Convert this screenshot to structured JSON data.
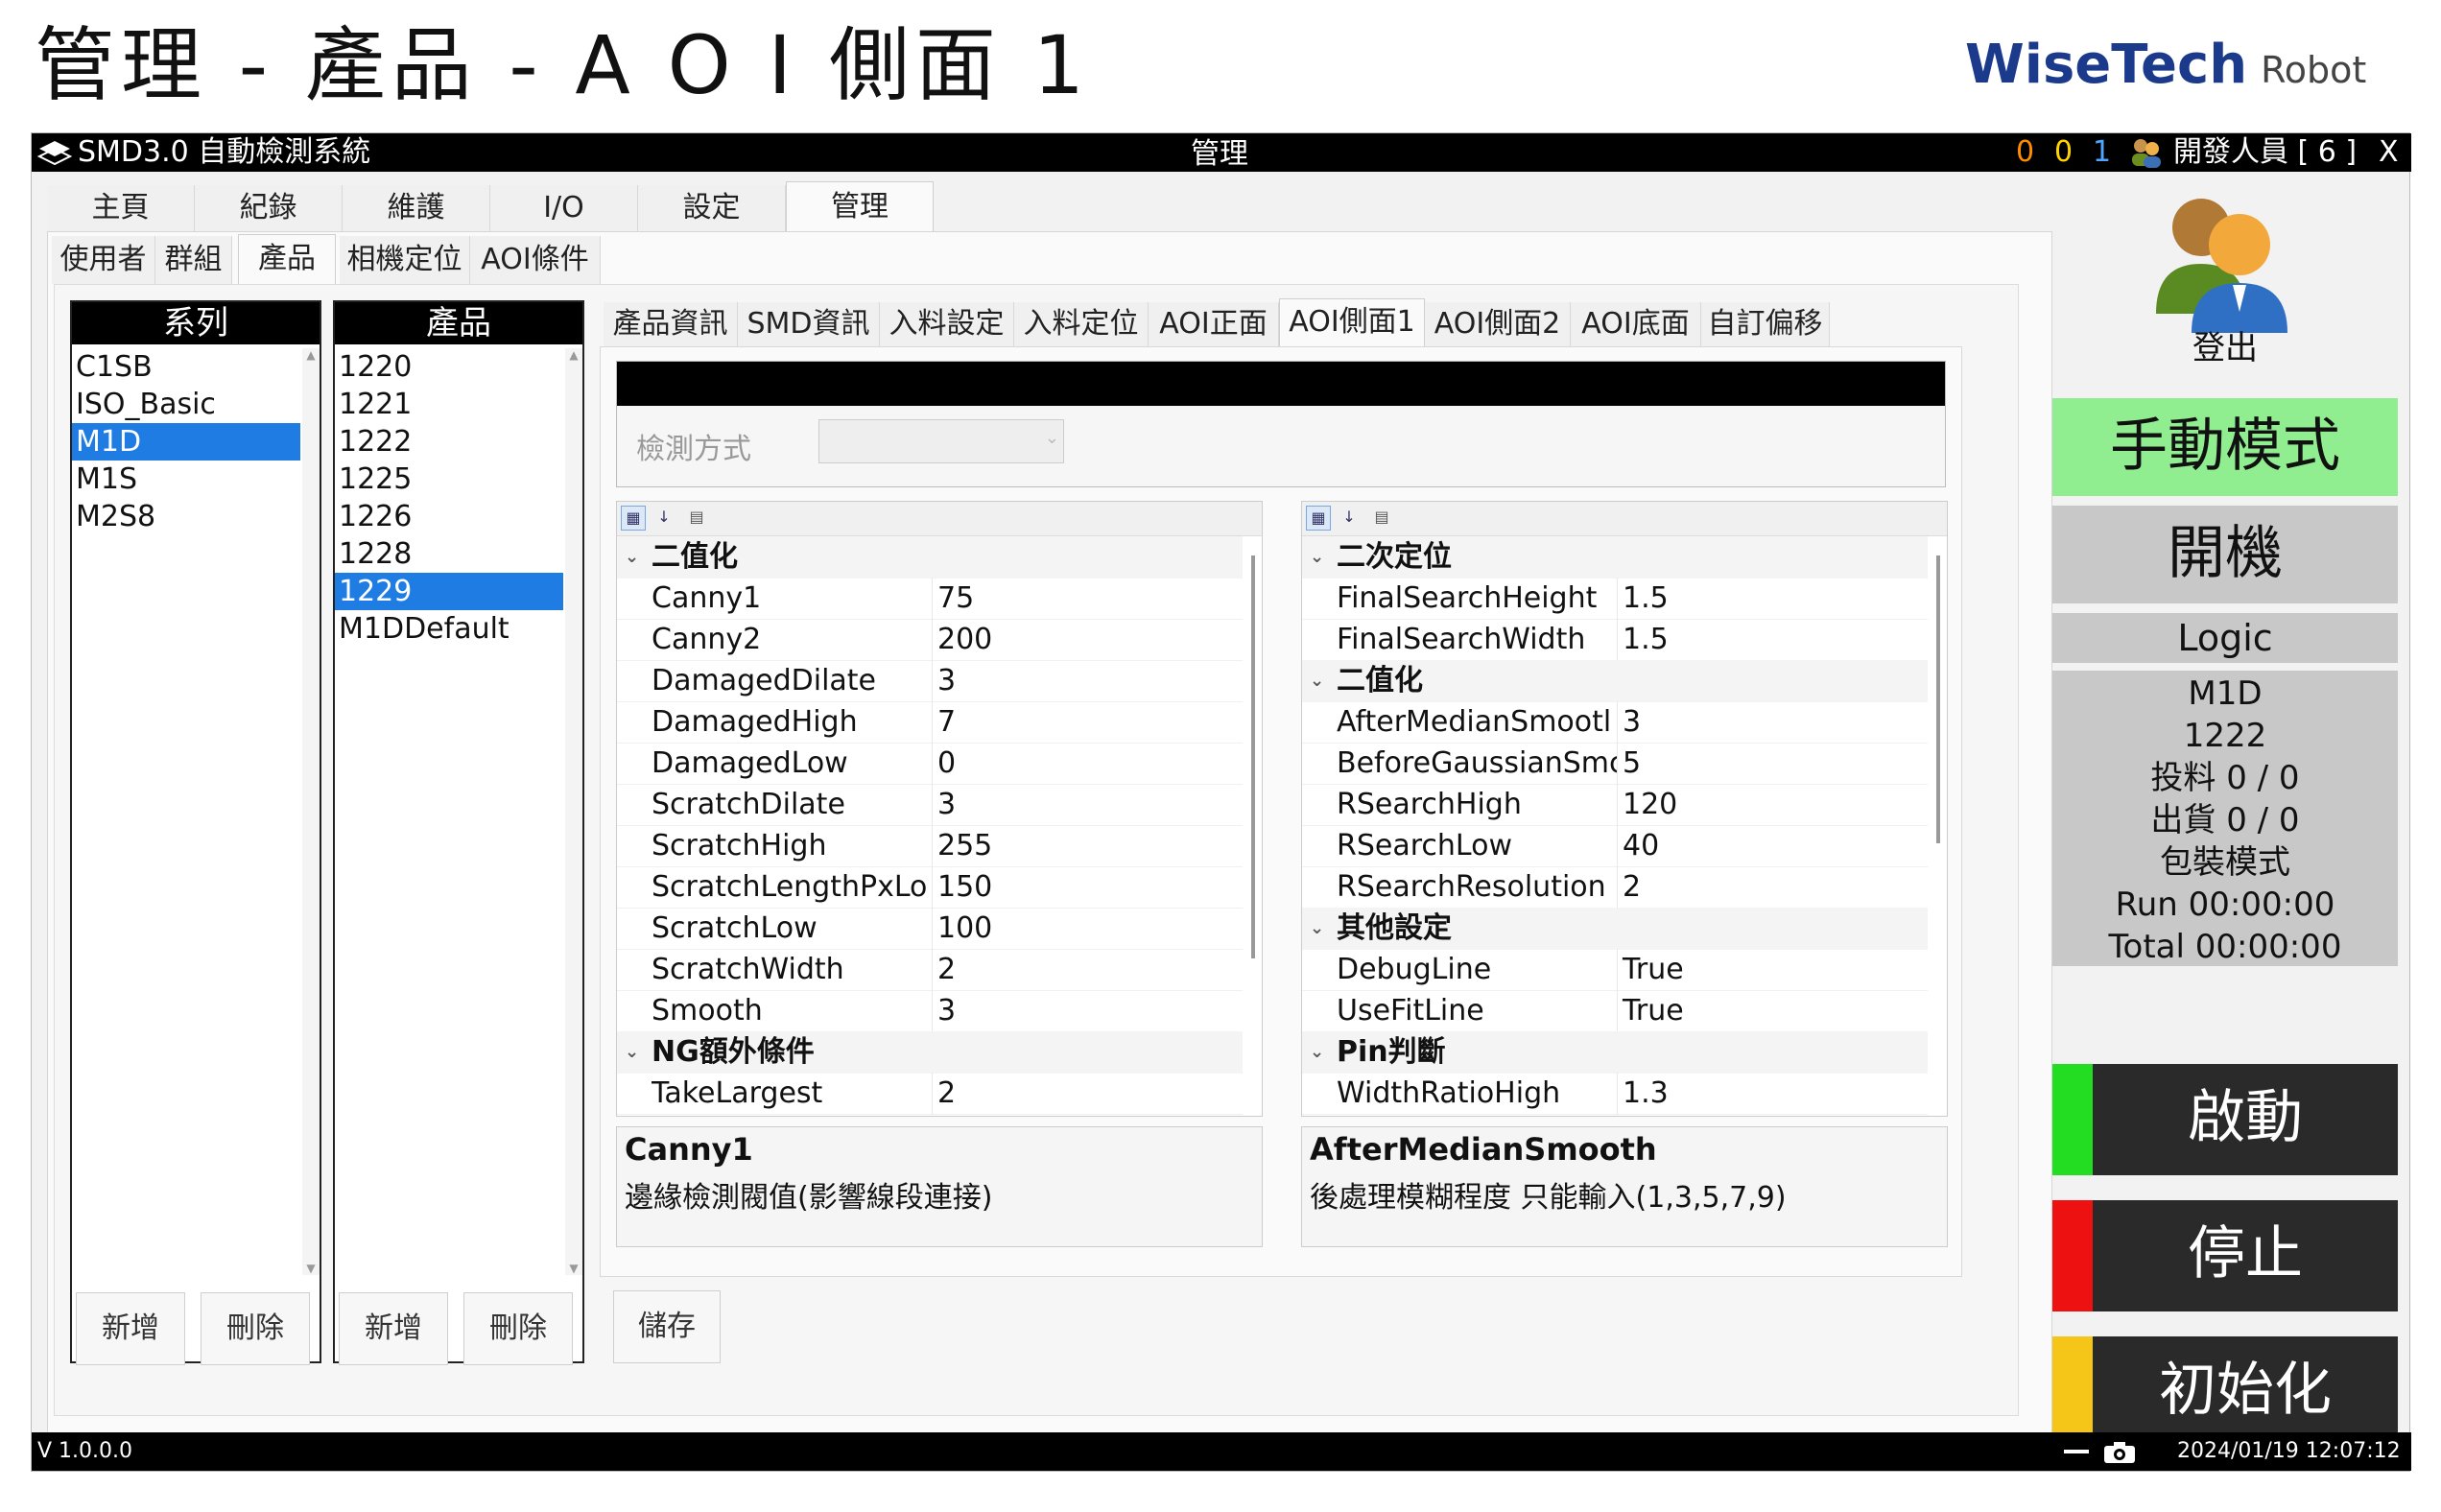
{
  "page_title": "管理 - 產品 - A O I 側面 1",
  "logo": {
    "brand": "WiseTech",
    "suffix": "Robot"
  },
  "titlebar": {
    "app_name": "SMD3.0 自動檢測系統",
    "center_title": "管理",
    "counts": [
      "0",
      "0",
      "1"
    ],
    "count_colors": [
      "#ff8c00",
      "#ffd400",
      "#4da6ff"
    ],
    "user": "開發人員 [ 6 ]",
    "close": "X"
  },
  "main_tabs": [
    "主頁",
    "紀錄",
    "維護",
    "I/O",
    "設定",
    "管理"
  ],
  "sub_tabs": [
    "使用者",
    "群組",
    "產品",
    "相機定位",
    "AOI條件"
  ],
  "series": {
    "header": "系列",
    "items": [
      "C1SB",
      "ISO_Basic",
      "M1D",
      "M1S",
      "M2S8"
    ],
    "selected": "M1D",
    "add": "新增",
    "delete": "刪除"
  },
  "products": {
    "header": "產品",
    "items": [
      "1220",
      "1221",
      "1222",
      "1225",
      "1226",
      "1228",
      "1229",
      "M1DDefault"
    ],
    "selected": "1229",
    "add": "新增",
    "delete": "刪除"
  },
  "detail_tabs": [
    "產品資訊",
    "SMD資訊",
    "入料設定",
    "入料定位",
    "AOI正面",
    "AOI側面1",
    "AOI側面2",
    "AOI底面",
    "自訂偏移"
  ],
  "detect_label": "檢測方式",
  "grid_left": {
    "rows": [
      {
        "cat": "二值化"
      },
      {
        "name": "Canny1",
        "value": "75"
      },
      {
        "name": "Canny2",
        "value": "200"
      },
      {
        "name": "DamagedDilate",
        "value": "3"
      },
      {
        "name": "DamagedHigh",
        "value": "7"
      },
      {
        "name": "DamagedLow",
        "value": "0"
      },
      {
        "name": "ScratchDilate",
        "value": "3"
      },
      {
        "name": "ScratchHigh",
        "value": "255"
      },
      {
        "name": "ScratchLengthPxLo",
        "value": "150"
      },
      {
        "name": "ScratchLow",
        "value": "100"
      },
      {
        "name": "ScratchWidth",
        "value": "2"
      },
      {
        "name": "Smooth",
        "value": "3"
      },
      {
        "cat": "NG額外條件"
      },
      {
        "name": "TakeLargest",
        "value": "2"
      }
    ],
    "desc_title": "Canny1",
    "desc_text": "邊緣檢測閥值(影響線段連接)"
  },
  "grid_right": {
    "rows": [
      {
        "cat": "二次定位"
      },
      {
        "name": "FinalSearchHeight",
        "value": "1.5"
      },
      {
        "name": "FinalSearchWidth",
        "value": "1.5"
      },
      {
        "cat": "二值化"
      },
      {
        "name": "AfterMedianSmootl",
        "value": "3"
      },
      {
        "name": "BeforeGaussianSmc",
        "value": "5"
      },
      {
        "name": "RSearchHigh",
        "value": "120"
      },
      {
        "name": "RSearchLow",
        "value": "40"
      },
      {
        "name": "RSearchResolution",
        "value": "2"
      },
      {
        "cat": "其他設定"
      },
      {
        "name": "DebugLine",
        "value": "True"
      },
      {
        "name": "UseFitLine",
        "value": "True"
      },
      {
        "cat": "Pin判斷"
      },
      {
        "name": "WidthRatioHigh",
        "value": "1.3"
      }
    ],
    "desc_title": "AfterMedianSmooth",
    "desc_text": "後處理模糊程度 只能輸入(1,3,5,7,9)"
  },
  "save": "儲存",
  "side": {
    "logout": "登出",
    "manual": "手動模式",
    "power": "開機",
    "logic": "Logic",
    "status_lines": [
      "M1D",
      "1222",
      "投料 0 / 0",
      "出貨 0 / 0",
      "包裝模式",
      "Run 00:00:00",
      "Total 00:00:00"
    ],
    "start": "啟動",
    "stop": "停止",
    "init": "初始化",
    "colors": {
      "manual": "#90ee90",
      "start_ind": "#22dd22",
      "stop_ind": "#ee1111",
      "init_ind": "#f5c518"
    }
  },
  "statusbar": {
    "version": "V 1.0.0.0",
    "datetime": "2024/01/19 12:07:12"
  }
}
